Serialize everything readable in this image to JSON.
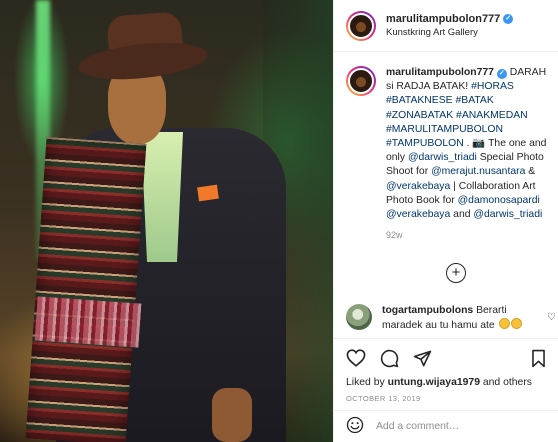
{
  "post": {
    "username": "marulitampubolon777",
    "location": "Kunstkring Art Gallery"
  },
  "caption": {
    "username": "marulitampubolon777",
    "line1": " DARAH si RADJA BATAK!",
    "hashtags": "#HORAS #BATAKNESE #BATAK #ZONABATAK #ANAKMEDAN #MARULITAMPUBOLON #TAMPUBOLON",
    "sep": " . 📷 The one and only ",
    "mention1": "@darwis_triadi",
    "text2": " Special Photo Shoot for ",
    "mention2": "@merajut.nusantara",
    "amp": " & ",
    "mention3": "@verakebaya",
    "text3": " | Collaboration Art Photo Book for ",
    "mention4": "@damonosapardi",
    "sp": " ",
    "mention5": "@verakebaya",
    "and": " and ",
    "mention6": "@darwis_triadi",
    "age": "92w"
  },
  "comment": {
    "username": "togartampubolons",
    "text": " Berarti maradek au tu hamu ate"
  },
  "likes": {
    "prefix": "Liked by ",
    "user": "untung.wijaya1979",
    "suffix": " and others"
  },
  "date": "OCTOBER 13, 2019",
  "add_comment": {
    "placeholder": "Add a comment…"
  },
  "icons": [
    "heart-icon",
    "comment-icon",
    "share-icon",
    "bookmark-icon",
    "emoji-icon",
    "verified-icon",
    "plus-circle-icon"
  ]
}
